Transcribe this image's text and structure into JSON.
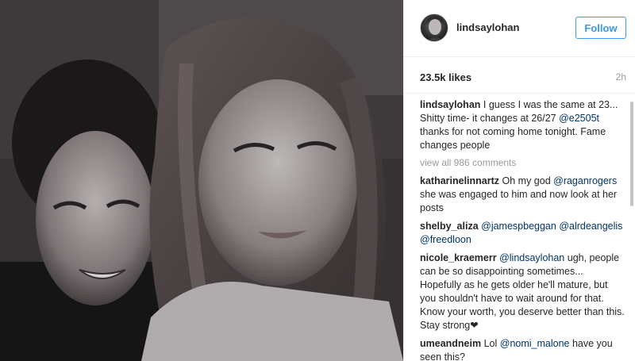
{
  "post": {
    "username": "lindsaylohan",
    "follow_label": "Follow",
    "likes": "23.5k likes",
    "time_ago": "2h",
    "view_all": "view all 986 comments"
  },
  "caption": {
    "author": "lindsaylohan",
    "text_1": " I guess I was the same at 23... Shitty time- it changes at 26/27 ",
    "mention": "@e2505t",
    "text_2": " thanks for not coming home tonight. Fame changes people"
  },
  "comments": [
    {
      "author": "katharinelinnartz",
      "parts": [
        {
          "t": " Oh my god ",
          "m": false
        },
        {
          "t": "@raganrogers",
          "m": true
        },
        {
          "t": " she was engaged to him and now look at her posts",
          "m": false
        }
      ]
    },
    {
      "author": "shelby_aliza",
      "parts": [
        {
          "t": " ",
          "m": false
        },
        {
          "t": "@jamespbeggan",
          "m": true
        },
        {
          "t": " ",
          "m": false
        },
        {
          "t": "@alrdeangelis",
          "m": true
        },
        {
          "t": " ",
          "m": false
        },
        {
          "t": "@freedloon",
          "m": true
        }
      ]
    },
    {
      "author": "nicole_kraemerr",
      "parts": [
        {
          "t": " ",
          "m": false
        },
        {
          "t": "@lindsaylohan",
          "m": true
        },
        {
          "t": " ugh, people can be so disappointing sometimes... Hopefully as he gets older he'll mature, but you shouldn't have to wait around for that. Know your worth, you deserve better than this. Stay strong❤",
          "m": false
        }
      ]
    },
    {
      "author": "umeandneim",
      "parts": [
        {
          "t": " Lol ",
          "m": false
        },
        {
          "t": "@nomi_malone",
          "m": true
        },
        {
          "t": " have you seen this?",
          "m": false
        }
      ]
    }
  ],
  "colors": {
    "accent": "#3897f0",
    "mention": "#003569",
    "muted": "#999999"
  }
}
